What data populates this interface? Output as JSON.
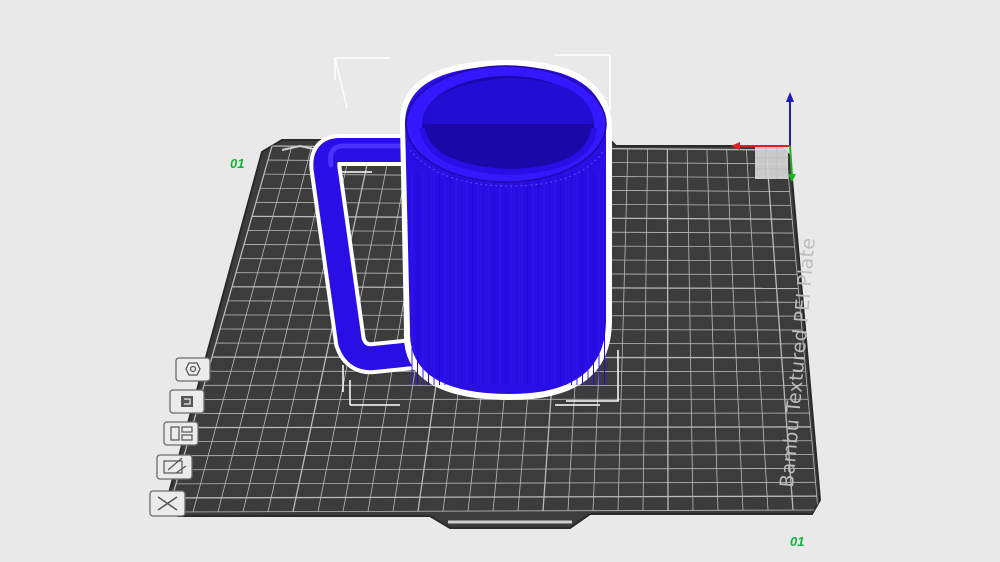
{
  "viewport": {
    "plate_name": "Bambu Textured PEI Plate",
    "plate_index_label": "01",
    "plate_bottom_label": "01"
  },
  "colors": {
    "background": "#e9e9e9",
    "bed": "#3c3c3c",
    "grid": "#b9b9b9",
    "model": "#2a0ee6",
    "selection": "#ffffff",
    "axis_x": "#e02020",
    "axis_y": "#19b419",
    "axis_z": "#1e1eb4",
    "plate_label_green": "#13b13b"
  },
  "toolbar": {
    "buttons": [
      {
        "icon": "orient-icon"
      },
      {
        "icon": "arrange-icon"
      },
      {
        "icon": "layout-icon"
      },
      {
        "icon": "edit-plate-icon"
      },
      {
        "icon": "delete-plate-icon"
      }
    ]
  },
  "model": {
    "type": "mug",
    "selected": true
  }
}
